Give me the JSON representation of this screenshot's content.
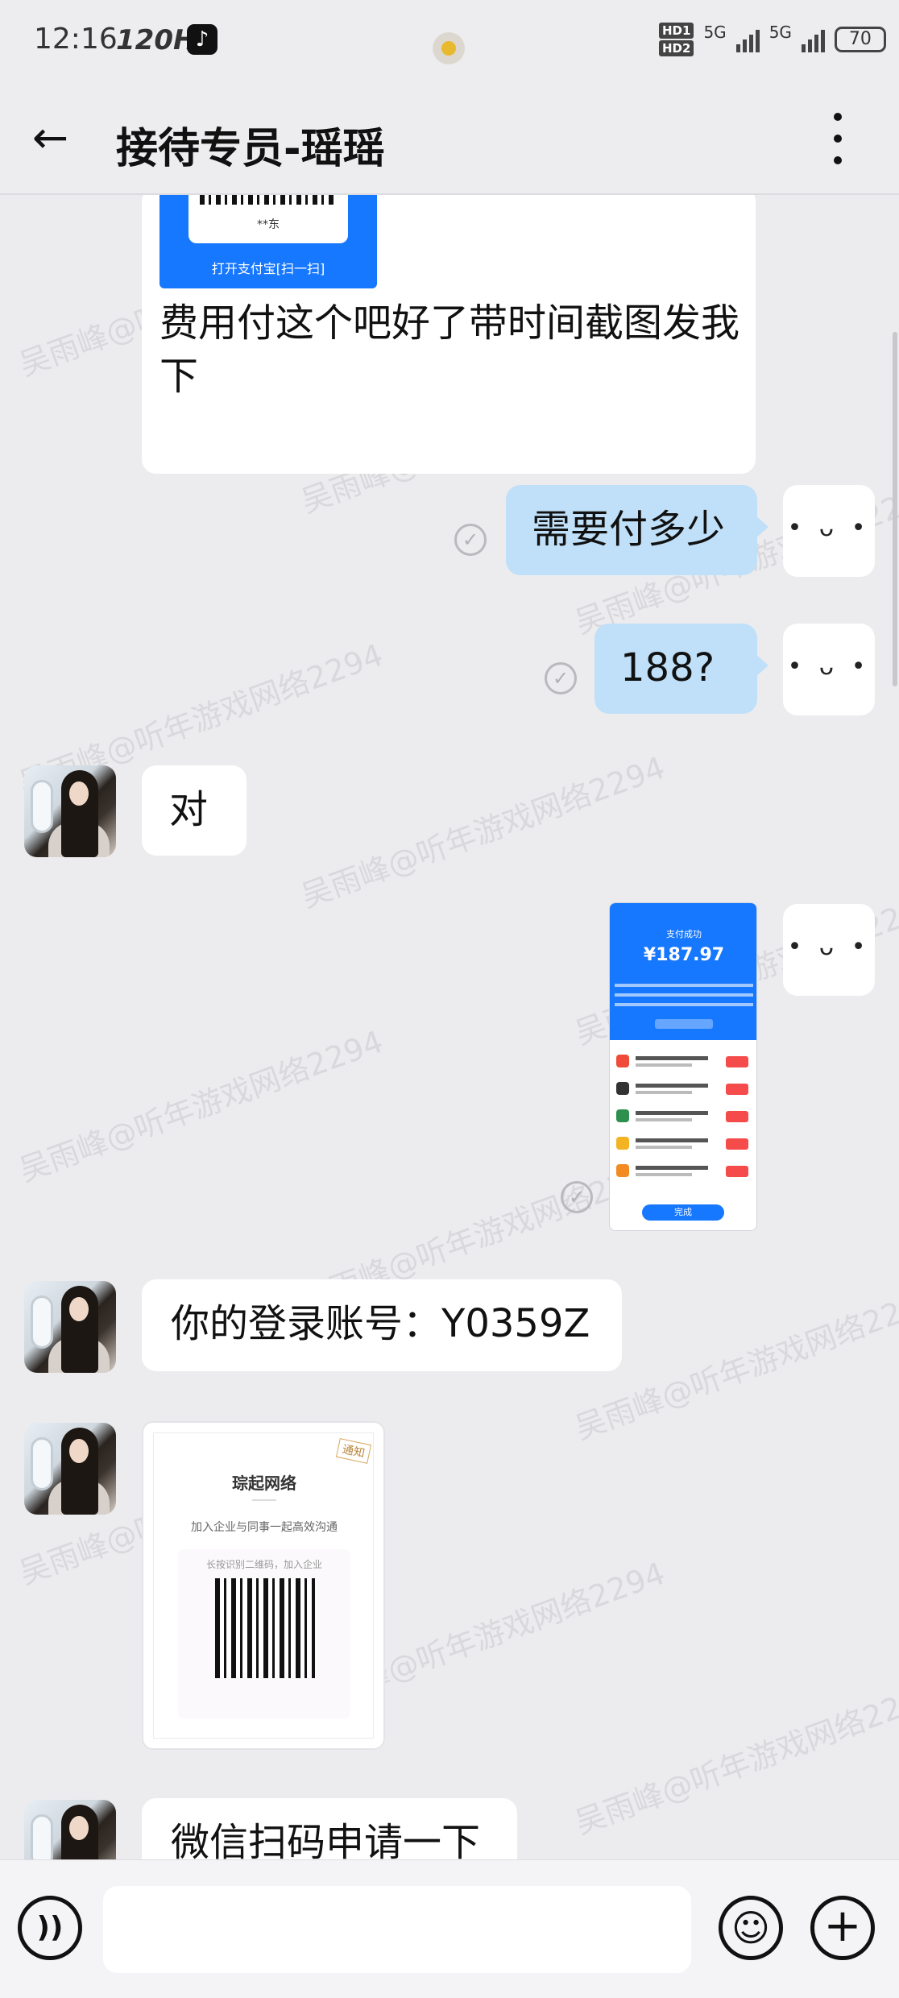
{
  "status_bar": {
    "time": "12:16",
    "refresh_rate": "120Hz",
    "app_icon": "tiktok-icon",
    "hd1": "HD1",
    "hd2": "HD2",
    "network1": "5G",
    "network2": "5G",
    "battery": "70"
  },
  "header": {
    "back_icon": "←",
    "title": "接待专员-瑶瑶",
    "more_icon": "more-vertical-icon"
  },
  "watermark": "吴雨峰@听年游戏网络2294",
  "messages": [
    {
      "id": "m1",
      "side": "left",
      "text": "费用付这个吧好了带时间截图发我下",
      "attachment": "alipay-qr",
      "attachment_text": "打开支付宝[扫一扫]",
      "qr_caption": "**东"
    },
    {
      "id": "m2",
      "side": "right",
      "text": "需要付多少",
      "status": "read"
    },
    {
      "id": "m3",
      "side": "right",
      "text": "188?",
      "status": "read"
    },
    {
      "id": "m4",
      "side": "left",
      "text": "对"
    },
    {
      "id": "m5",
      "side": "right",
      "type": "image",
      "image": {
        "amount": "¥187.97",
        "label": "支付成功",
        "done": "完成"
      },
      "status": "read"
    },
    {
      "id": "m6",
      "side": "left",
      "text": "你的登录账号：Y0359Z"
    },
    {
      "id": "m7",
      "side": "left",
      "type": "card",
      "card": {
        "tag": "通知",
        "title": "琮起网络",
        "subtitle": "加入企业与同事一起高效沟通",
        "hint": "长按识别二维码，加入企业"
      }
    },
    {
      "id": "m8",
      "side": "left",
      "text": "微信扫码申请一下"
    }
  ],
  "self_avatar": "• ᴗ •",
  "composer": {
    "voice_icon": "voice-icon",
    "emoji_icon": "emoji-icon",
    "plus_icon": "plus-icon",
    "input_value": ""
  },
  "colors": {
    "bg": "#ececef",
    "my_bubble": "#bfe0f8",
    "alipay_blue": "#1677ff"
  }
}
